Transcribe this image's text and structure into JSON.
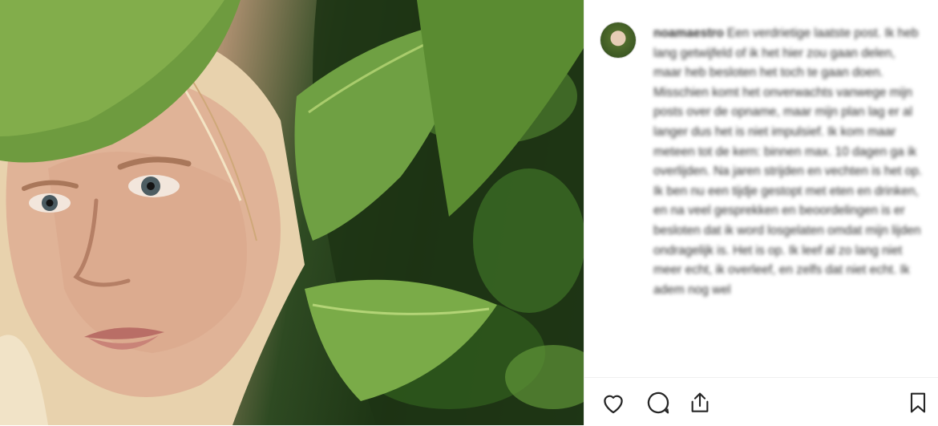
{
  "post": {
    "username": "noamaestro",
    "caption": "Een verdrietige laatste post. Ik heb lang getwijfeld of ik het hier zou gaan delen, maar heb besloten het toch te gaan doen. Misschien komt het onverwachts vanwege mijn posts over de opname, maar mijn plan lag er al langer dus het is niet impulsief. Ik kom maar meteen tot de kern: binnen max. 10 dagen ga ik overlijden. Na jaren strijden en vechten is het op. Ik ben nu een tijdje gestopt met eten en drinken, en na veel gesprekken en beoordelingen is er besloten dat ik word losgelaten omdat mijn lijden ondragelijk is. Het is op. Ik leef al zo lang niet meer echt, ik overleef, en zelfs dat niet echt. Ik adem nog wel"
  },
  "actions": {
    "like_icon": "heart-outline-icon",
    "comment_icon": "speech-bubble-icon",
    "share_icon": "share-upload-icon",
    "save_icon": "bookmark-outline-icon"
  },
  "colors": {
    "background": "#ffffff",
    "caption_text": "#303030",
    "icon": "#262626",
    "divider": "#efefef"
  }
}
